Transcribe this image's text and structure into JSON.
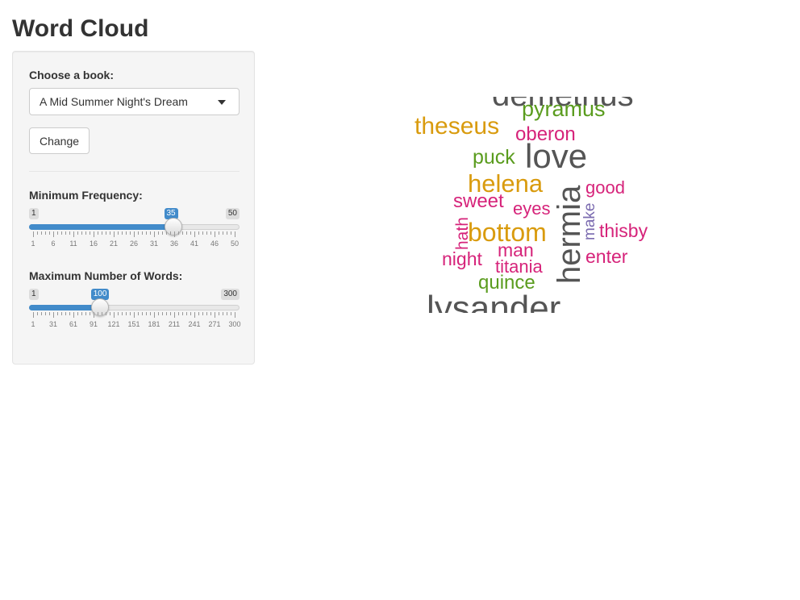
{
  "page": {
    "title": "Word Cloud"
  },
  "sidebar": {
    "book_label": "Choose a book:",
    "book_selected": "A Mid Summer Night's Dream",
    "change_label": "Change",
    "min_freq": {
      "label": "Minimum Frequency:",
      "min": "1",
      "max": "50",
      "value": "35",
      "fraction": 0.694,
      "ticks": [
        "1",
        "6",
        "11",
        "16",
        "21",
        "26",
        "31",
        "36",
        "41",
        "46",
        "50"
      ]
    },
    "max_words": {
      "label": "Maximum Number of Words:",
      "min": "1",
      "max": "300",
      "value": "100",
      "fraction": 0.331,
      "ticks": [
        "1",
        "31",
        "61",
        "91",
        "121",
        "151",
        "181",
        "211",
        "241",
        "271",
        "300"
      ]
    }
  },
  "cloud": {
    "colors": {
      "gray": "#555555",
      "orange": "#d99b0e",
      "green": "#5a9c1e",
      "magenta": "#d6237a",
      "purple": "#7b6bb0"
    },
    "words": [
      {
        "text": "demetrius",
        "color": "#555555"
      },
      {
        "text": "pyramus",
        "color": "#5a9c1e"
      },
      {
        "text": "theseus",
        "color": "#d99b0e"
      },
      {
        "text": "oberon",
        "color": "#d6237a"
      },
      {
        "text": "puck",
        "color": "#5a9c1e"
      },
      {
        "text": "love",
        "color": "#555555"
      },
      {
        "text": "helena",
        "color": "#d99b0e"
      },
      {
        "text": "hermia",
        "color": "#555555"
      },
      {
        "text": "good",
        "color": "#d6237a"
      },
      {
        "text": "sweet",
        "color": "#d6237a"
      },
      {
        "text": "eyes",
        "color": "#d6237a"
      },
      {
        "text": "make",
        "color": "#7b6bb0"
      },
      {
        "text": "hath",
        "color": "#d6237a"
      },
      {
        "text": "bottom",
        "color": "#d99b0e"
      },
      {
        "text": "thisby",
        "color": "#d6237a"
      },
      {
        "text": "night",
        "color": "#d6237a"
      },
      {
        "text": "man",
        "color": "#d6237a"
      },
      {
        "text": "enter",
        "color": "#d6237a"
      },
      {
        "text": "titania",
        "color": "#d6237a"
      },
      {
        "text": "quince",
        "color": "#5a9c1e"
      },
      {
        "text": "lysander",
        "color": "#555555"
      }
    ]
  }
}
